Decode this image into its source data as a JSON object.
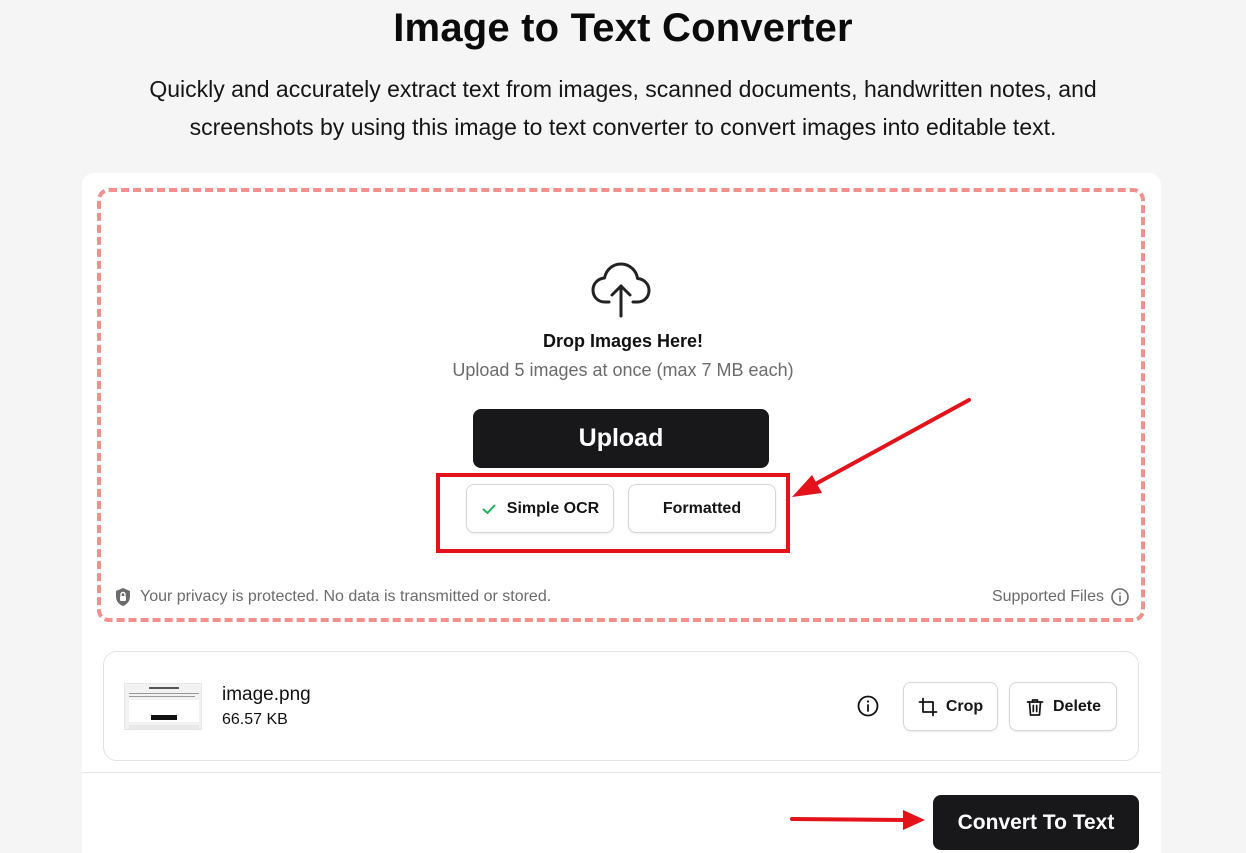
{
  "header": {
    "title": "Image to Text Converter",
    "subtitle": "Quickly and accurately extract text from images, scanned documents, handwritten notes, and screenshots by using this image to text converter to convert images into editable text."
  },
  "dropzone": {
    "icon": "cloud-upload-icon",
    "title": "Drop Images Here!",
    "subtitle": "Upload 5 images at once (max 7 MB each)",
    "upload_label": "Upload",
    "modes": [
      {
        "label": "Simple OCR",
        "selected": true,
        "icon": "check-icon"
      },
      {
        "label": "Formatted",
        "selected": false
      }
    ],
    "privacy_text": "Your privacy is protected. No data is transmitted or stored.",
    "supported_label": "Supported Files"
  },
  "file": {
    "name": "image.png",
    "size": "66.57 KB",
    "crop_label": "Crop",
    "delete_label": "Delete"
  },
  "footer": {
    "convert_label": "Convert To Text"
  },
  "colors": {
    "accent_dark": "#18181b",
    "dashed_border": "#f3908b",
    "annotation_red": "#e3121b",
    "check_green": "#22b35a"
  }
}
